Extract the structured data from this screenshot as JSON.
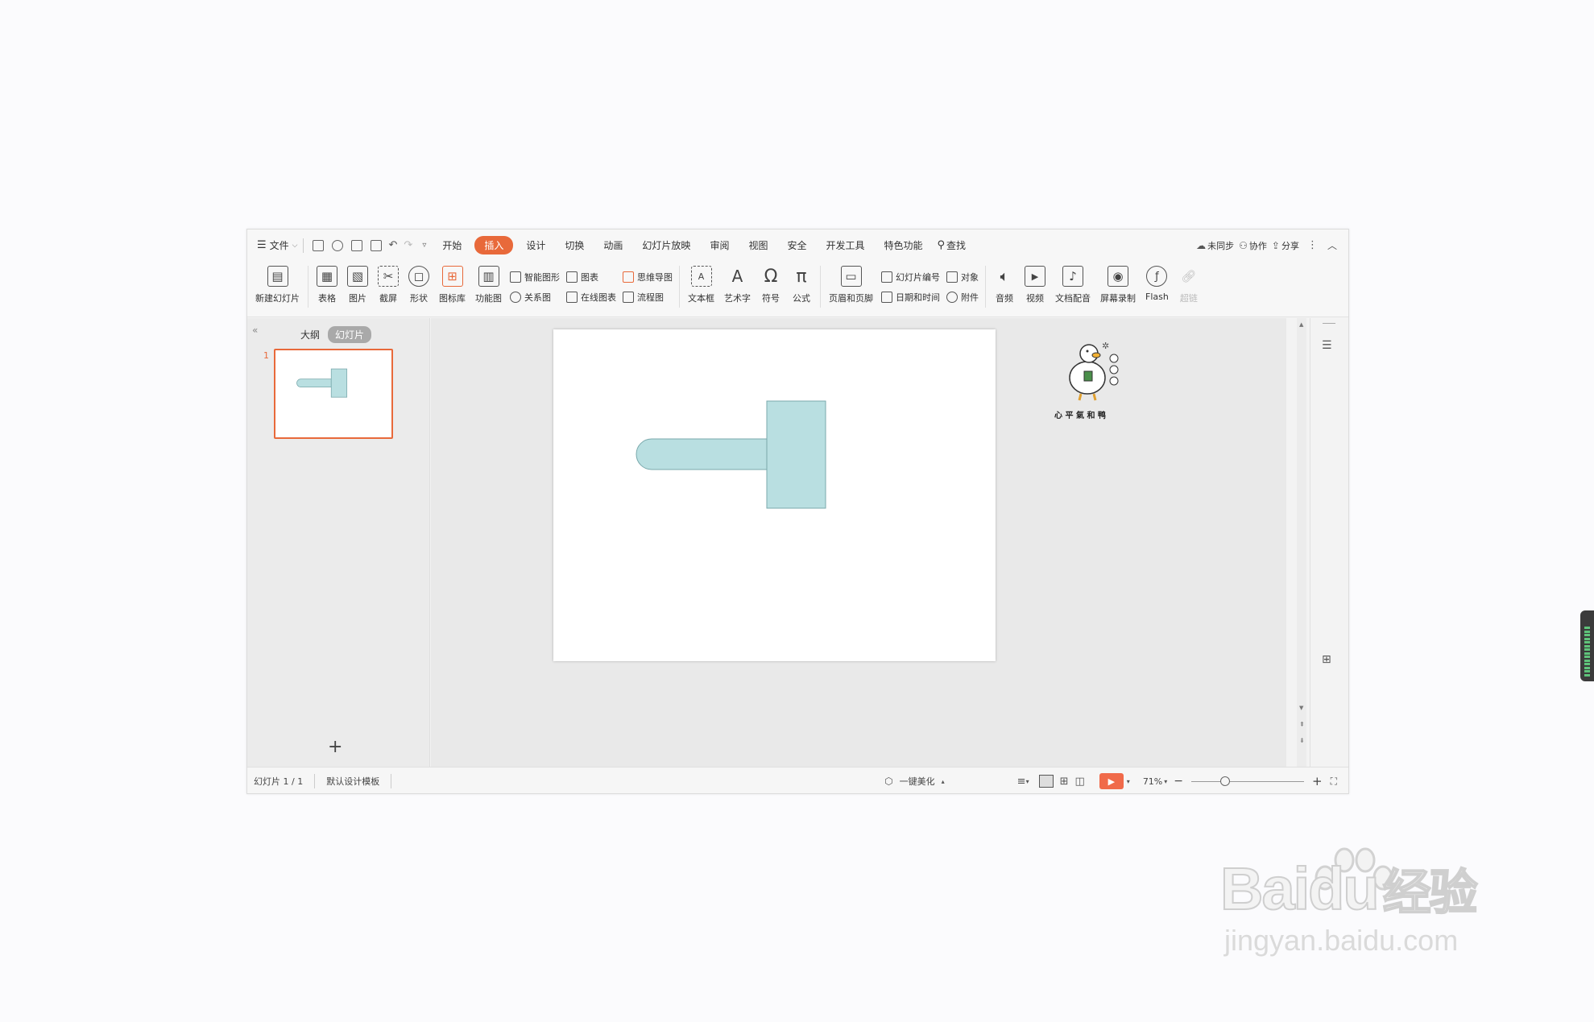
{
  "menubar": {
    "file": "文件",
    "tabs": [
      {
        "label": "开始"
      },
      {
        "label": "插入",
        "active": true
      },
      {
        "label": "设计"
      },
      {
        "label": "切换"
      },
      {
        "label": "动画"
      },
      {
        "label": "幻灯片放映"
      },
      {
        "label": "审阅"
      },
      {
        "label": "视图"
      },
      {
        "label": "安全"
      },
      {
        "label": "开发工具"
      },
      {
        "label": "特色功能"
      }
    ],
    "search": "查找",
    "sync": "未同步",
    "collab": "协作",
    "share": "分享"
  },
  "ribbon": {
    "new_slide": "新建幻灯片",
    "table": "表格",
    "picture": "图片",
    "screenshot": "截屏",
    "shape": "形状",
    "icon_lib": "图标库",
    "func_chart": "功能图",
    "smart_art": "智能图形",
    "chart": "图表",
    "relation": "关系图",
    "online_chart": "在线图表",
    "mindmap": "思维导图",
    "flowchart": "流程图",
    "textbox": "文本框",
    "wordart": "艺术字",
    "symbol": "符号",
    "formula": "公式",
    "header_footer": "页眉和页脚",
    "slide_number": "幻灯片编号",
    "object": "对象",
    "datetime": "日期和时间",
    "attachment": "附件",
    "audio": "音频",
    "video": "视频",
    "doc_voice": "文档配音",
    "screen_record": "屏幕录制",
    "flash": "Flash",
    "hyperlink": "超链"
  },
  "leftpane": {
    "tab_outline": "大纲",
    "tab_slides": "幻灯片",
    "slide_index": "1",
    "add": "+"
  },
  "sticker": {
    "text": "心 平 氣 和 鸭"
  },
  "status": {
    "slide_count": "幻灯片 1 / 1",
    "template": "默认设计模板",
    "beautify": "一键美化",
    "zoom": "71%",
    "zoom_value": 0.71
  },
  "slide_shape": {
    "fill": "#b9dfe1",
    "stroke": "#7aa9ac"
  },
  "watermark": {
    "brand": "Bai",
    "brand2": "du",
    "cn": "经验",
    "url": "jingyan.baidu.com"
  }
}
